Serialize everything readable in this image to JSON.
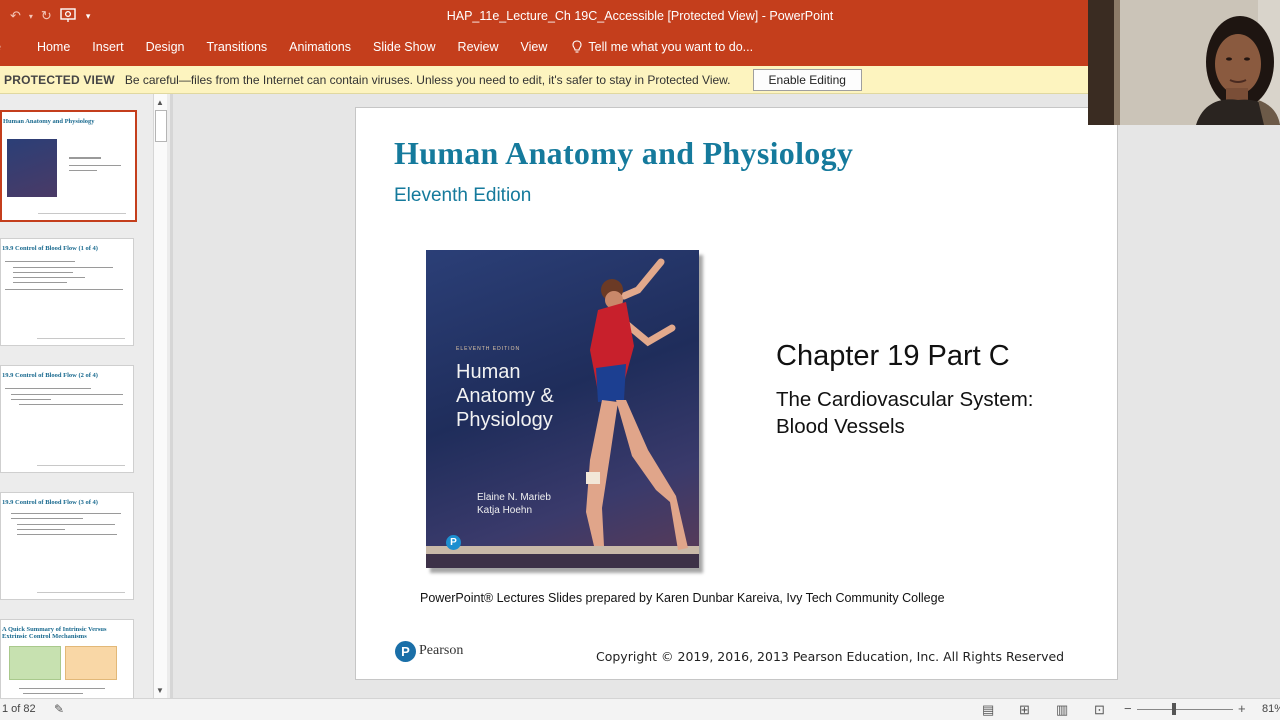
{
  "app": {
    "window_title": "HAP_11e_Lecture_Ch 19C_Accessible [Protected View] - PowerPoint"
  },
  "quick_access": {
    "icons": [
      "undo-icon",
      "redo-icon",
      "presenter-icon",
      "customize-icon"
    ]
  },
  "ribbon": {
    "tabs": [
      "Home",
      "Insert",
      "Design",
      "Transitions",
      "Animations",
      "Slide Show",
      "Review",
      "View"
    ],
    "tell_me": "Tell me what you want to do..."
  },
  "protected_view": {
    "label": "PROTECTED VIEW",
    "message": "Be careful—files from the Internet can contain viruses. Unless you need to edit, it's safer to stay in Protected View.",
    "button": "Enable Editing"
  },
  "thumbnails": [
    {
      "title": "Human Anatomy and Physiology",
      "selected": true
    },
    {
      "title": "19.9 Control of Blood Flow (1 of 4)",
      "selected": false
    },
    {
      "title": "19.9 Control of Blood Flow (2 of 4)",
      "selected": false
    },
    {
      "title": "19.9 Control of Blood Flow (3 of 4)",
      "selected": false
    },
    {
      "title": "A Quick Summary of Intrinsic Versus Extrinsic Control Mechanisms",
      "selected": false
    }
  ],
  "slide": {
    "title": "Human Anatomy and Physiology",
    "edition": "Eleventh Edition",
    "cover": {
      "small": "ELEVENTH EDITION",
      "line1": "Human",
      "line2": "Anatomy &",
      "line3": "Physiology",
      "author1": "Elaine N. Marieb",
      "author2": "Katja Hoehn",
      "logo": "P"
    },
    "chapter": "Chapter 19 Part C",
    "subtitle_line1": "The Cardiovascular System:",
    "subtitle_line2": "Blood Vessels",
    "credit": "PowerPoint® Lectures Slides prepared by Karen Dunbar Kareiva, Ivy Tech Community College",
    "publisher": "Pearson",
    "publisher_logo": "P",
    "copyright": "Copyright © 2019, 2016, 2013 Pearson Education, Inc. All Rights Reserved"
  },
  "status": {
    "slide_count": "1 of 82",
    "zoom": "81%"
  },
  "colors": {
    "ribbon": "#c43e1c",
    "protected_bar": "#fdf4bf",
    "slide_title": "#157a9c"
  }
}
